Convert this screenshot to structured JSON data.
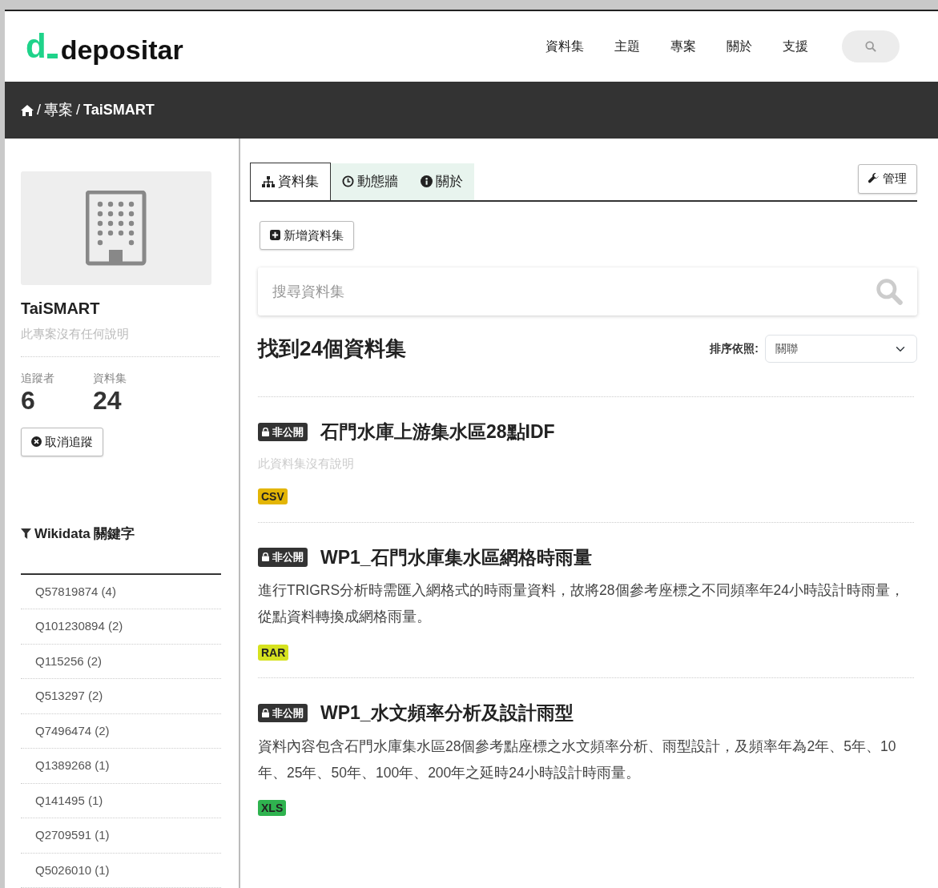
{
  "logo": {
    "mark": "d",
    "name": "depositar"
  },
  "nav": [
    {
      "label": "資料集"
    },
    {
      "label": "主題"
    },
    {
      "label": "專案"
    },
    {
      "label": "關於"
    },
    {
      "label": "支援"
    }
  ],
  "breadcrumb": [
    {
      "separator": "/",
      "label": "專案"
    },
    {
      "separator": "/",
      "label": "TaiSMART"
    }
  ],
  "sidebar": {
    "title": "TaiSMART",
    "description": "此專案沒有任何說明",
    "stats": [
      {
        "label": "追蹤者",
        "value": "6"
      },
      {
        "label": "資料集",
        "value": "24"
      }
    ],
    "unfollow_button": "取消追蹤",
    "facet_title": "Wikidata 關鍵字",
    "facet_items": [
      {
        "label": "Q57819874 (4)"
      },
      {
        "label": "Q101230894 (2)"
      },
      {
        "label": "Q115256 (2)"
      },
      {
        "label": "Q513297 (2)"
      },
      {
        "label": "Q7496474 (2)"
      },
      {
        "label": "Q1389268 (1)"
      },
      {
        "label": "Q141495 (1)"
      },
      {
        "label": "Q2709591 (1)"
      },
      {
        "label": "Q5026010 (1)"
      }
    ]
  },
  "tabs": [
    {
      "label": "資料集",
      "selected": true
    },
    {
      "label": "動態牆",
      "selected": false
    },
    {
      "label": "關於",
      "selected": false
    }
  ],
  "manage_button": "管理",
  "add_button": "新增資料集",
  "search": {
    "placeholder": "搜尋資料集"
  },
  "result_count": "找到24個資料集",
  "sort": {
    "label": "排序依照:",
    "value": "關聯"
  },
  "datasets": [
    {
      "badge": "非公開",
      "title": "石門水庫上游集水區28點IDF",
      "description": "此資料集沒有說明",
      "has_description": false,
      "format": "CSV",
      "color": "#e3b505"
    },
    {
      "badge": "非公開",
      "title": "WP1_石門水庫集水區網格時雨量",
      "description": "進行TRIGRS分析時需匯入網格式的時雨量資料，故將28個參考座標之不同頻率年24小時設計時雨量，從點資料轉換成網格雨量。",
      "has_description": true,
      "format": "RAR",
      "color": "#d6e21f"
    },
    {
      "badge": "非公開",
      "title": "WP1_水文頻率分析及設計雨型",
      "description": "資料內容包含石門水庫集水區28個參考點座標之水文頻率分析、雨型設計，及頻率年為2年、5年、10年、25年、50年、100年、200年之延時24小時設計時雨量。",
      "has_description": true,
      "format": "XLS",
      "color": "#2fb34f"
    }
  ]
}
